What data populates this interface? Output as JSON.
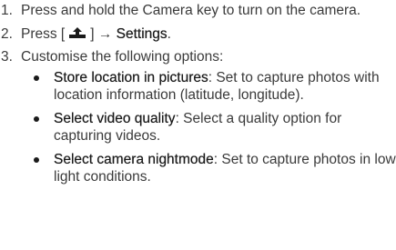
{
  "steps": [
    {
      "number": "1.",
      "text": "Press and hold the Camera key to turn on the camera."
    },
    {
      "number": "2.",
      "prefix": "Press [",
      "key_icon": "upload-tray-icon",
      "suffix": "] → ",
      "target": "Settings",
      "end": "."
    },
    {
      "number": "3.",
      "text": "Customise the following options:",
      "options": [
        {
          "name": "Store location in pictures",
          "description": ": Set to capture photos with location information (latitude, longitude)."
        },
        {
          "name": "Select video quality",
          "description": ": Select a quality option for capturing videos."
        },
        {
          "name": "Select camera nightmode",
          "description": ": Set to capture photos in low light conditions."
        }
      ]
    }
  ]
}
